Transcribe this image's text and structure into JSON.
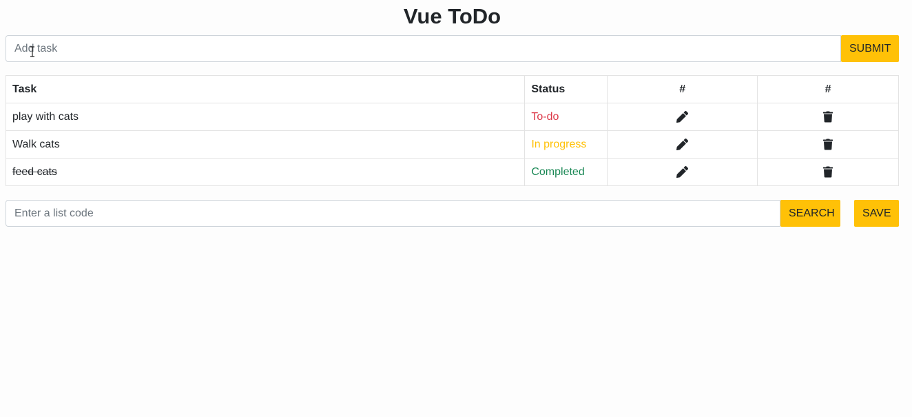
{
  "app": {
    "title": "Vue ToDo"
  },
  "add_task": {
    "placeholder": "Add task",
    "value": "",
    "submit_label": "SUBMIT"
  },
  "table": {
    "headers": [
      "Task",
      "Status",
      "#",
      "#"
    ],
    "rows": [
      {
        "task": "play with cats",
        "status": "To-do",
        "status_color": "#dc3545",
        "completed": false,
        "edit_icon": "pencil-icon",
        "delete_icon": "trash-icon"
      },
      {
        "task": "Walk cats",
        "status": "In progress",
        "status_color": "#ffc107",
        "completed": false,
        "edit_icon": "pencil-icon",
        "delete_icon": "trash-icon"
      },
      {
        "task": "feed cats",
        "status": "Completed",
        "status_color": "#198754",
        "completed": true,
        "edit_icon": "pencil-icon",
        "delete_icon": "trash-icon"
      }
    ]
  },
  "list_code": {
    "placeholder": "Enter a list code",
    "value": "",
    "search_label": "SEARCH",
    "save_label": "SAVE"
  },
  "colors": {
    "accent": "#ffc107",
    "todo": "#dc3545",
    "in_progress": "#ffc107",
    "completed": "#198754"
  }
}
